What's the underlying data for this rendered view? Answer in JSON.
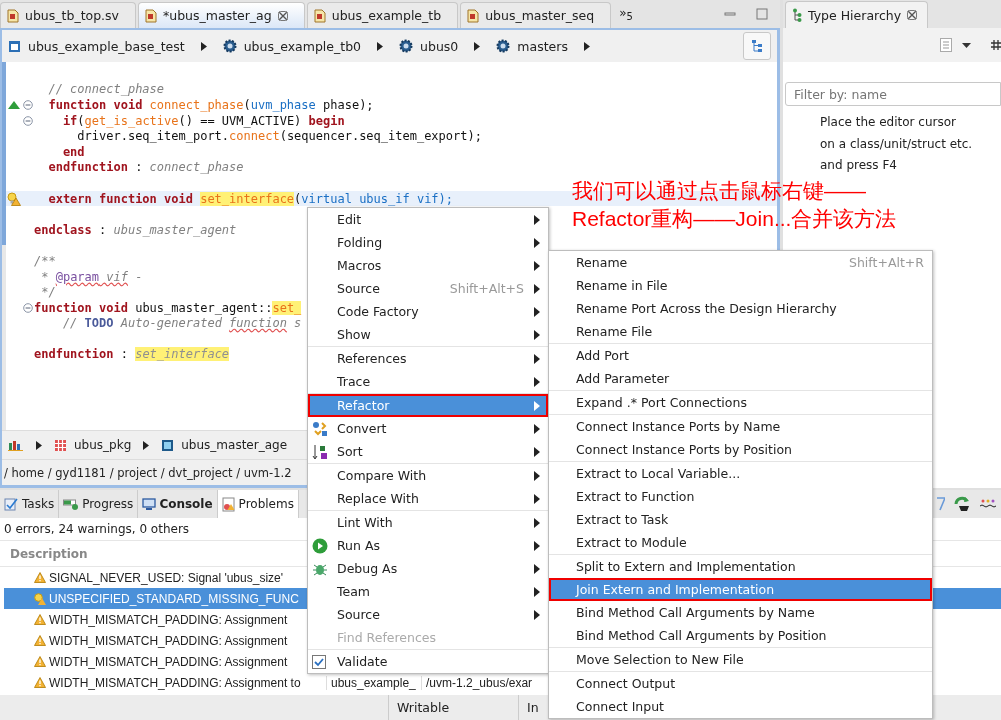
{
  "editor_tabs": [
    {
      "label": "ubus_tb_top.sv",
      "selected": false
    },
    {
      "label": "*ubus_master_ag",
      "selected": true
    },
    {
      "label": "ubus_example_tb",
      "selected": false
    },
    {
      "label": "ubus_master_seq",
      "selected": false
    }
  ],
  "tab_overflow": "»$_{5}$",
  "breadcrumb": [
    {
      "label": "ubus_example_base_test",
      "kind": "test"
    },
    {
      "label": "ubus_example_tb0",
      "kind": "instance"
    },
    {
      "label": "ubus0",
      "kind": "instance"
    },
    {
      "label": "masters",
      "kind": "instance"
    }
  ],
  "code_lines": [
    {
      "kind": "blank"
    },
    {
      "kind": "code",
      "fold": false,
      "current": false,
      "tokens": [
        {
          "text": "  // connect_phase",
          "kind": "comment"
        }
      ]
    },
    {
      "kind": "override",
      "fold": true,
      "current": false,
      "tokens": [
        {
          "text": "  function void ",
          "kind": "keyword"
        },
        {
          "text": "connect_phase",
          "kind": "function"
        },
        {
          "text": "(",
          "kind": "plain"
        },
        {
          "text": "uvm_phase",
          "kind": "type"
        },
        {
          "text": " phase);",
          "kind": "plain"
        }
      ]
    },
    {
      "kind": "code",
      "fold": true,
      "current": false,
      "tokens": [
        {
          "text": "    if",
          "kind": "keyword"
        },
        {
          "text": "(",
          "kind": "plain"
        },
        {
          "text": "get_is_active",
          "kind": "function"
        },
        {
          "text": "() == UVM_ACTIVE) ",
          "kind": "plain"
        },
        {
          "text": "begin",
          "kind": "keyword"
        }
      ]
    },
    {
      "kind": "code",
      "fold": false,
      "current": false,
      "tokens": [
        {
          "text": "      driver.seq_item_port.",
          "kind": "plain"
        },
        {
          "text": "connect",
          "kind": "function"
        },
        {
          "text": "(sequencer.seq_item_export);",
          "kind": "plain"
        }
      ]
    },
    {
      "kind": "code",
      "fold": false,
      "current": false,
      "tokens": [
        {
          "text": "    end",
          "kind": "keyword"
        }
      ]
    },
    {
      "kind": "code",
      "fold": false,
      "current": false,
      "tokens": [
        {
          "text": "  endfunction",
          "kind": "keyword"
        },
        {
          "text": " : ",
          "kind": "plain"
        },
        {
          "text": "connect_phase",
          "kind": "comment"
        }
      ]
    },
    {
      "kind": "blank"
    },
    {
      "kind": "warning",
      "fold": false,
      "current": true,
      "tokens": [
        {
          "text": "  extern function void ",
          "kind": "keyword"
        },
        {
          "text": "set_interface",
          "kind": "highlight"
        },
        {
          "text": "(",
          "kind": "plain"
        },
        {
          "text": "virtual ubus_if vif);",
          "kind": "type"
        }
      ]
    },
    {
      "kind": "blank"
    },
    {
      "kind": "code",
      "fold": false,
      "current": false,
      "tokens": [
        {
          "text": "endclass",
          "kind": "keyword"
        },
        {
          "text": " : ",
          "kind": "plain"
        },
        {
          "text": "ubus_master_agent",
          "kind": "comment"
        }
      ]
    },
    {
      "kind": "blank"
    },
    {
      "kind": "code",
      "fold": false,
      "current": false,
      "tokens": [
        {
          "text": "/**",
          "kind": "comment"
        }
      ]
    },
    {
      "kind": "code",
      "fold": false,
      "current": false,
      "tokens": [
        {
          "text": " * ",
          "kind": "comment"
        },
        {
          "text": "@param",
          "kind": "doctag"
        },
        {
          "text": " vif",
          "kind": "misspelled"
        },
        {
          "text": " -",
          "kind": "comment"
        }
      ]
    },
    {
      "kind": "code",
      "fold": false,
      "current": false,
      "tokens": [
        {
          "text": " */",
          "kind": "comment"
        }
      ]
    },
    {
      "kind": "code",
      "fold": true,
      "current": false,
      "tokens": [
        {
          "text": "function void ",
          "kind": "keyword"
        },
        {
          "text": "ubus_master_agent::",
          "kind": "plain"
        },
        {
          "text": "set_",
          "kind": "highlight"
        }
      ]
    },
    {
      "kind": "code",
      "fold": false,
      "current": false,
      "tokens": [
        {
          "text": "    // ",
          "kind": "comment"
        },
        {
          "text": "TODO",
          "kind": "todo"
        },
        {
          "text": " Auto-generated ",
          "kind": "comment"
        },
        {
          "text": "function",
          "kind": "misspelled"
        },
        {
          "text": " s",
          "kind": "comment"
        }
      ]
    },
    {
      "kind": "blank"
    },
    {
      "kind": "code",
      "fold": false,
      "current": false,
      "tokens": [
        {
          "text": "endfunction",
          "kind": "keyword"
        },
        {
          "text": " : ",
          "kind": "plain"
        },
        {
          "text": "set_interface",
          "kind": "highlight-italic"
        }
      ]
    }
  ],
  "breadcrumb_2": [
    {
      "label": "ubus_pkg",
      "kind": "package"
    },
    {
      "label": "ubus_master_age",
      "kind": "class"
    }
  ],
  "file_path": "/ home / gyd1181 / project / dvt_project / uvm-1.2",
  "type_hierarchy": {
    "title": "Type Hierarchy",
    "filter_placeholder": "Filter by: name",
    "message": [
      "Place the editor cursor",
      "on a class/unit/struct etc.",
      "and press F4"
    ]
  },
  "bottom_tabs": [
    {
      "label": "Tasks",
      "kind": "tasks",
      "selected": false,
      "bold": false
    },
    {
      "label": "Progress",
      "kind": "progress",
      "selected": false,
      "bold": false
    },
    {
      "label": "Console",
      "kind": "console",
      "selected": false,
      "bold": true
    },
    {
      "label": "Problems",
      "kind": "problems",
      "selected": true,
      "bold": false
    }
  ],
  "problems": {
    "summary": "0 errors, 24 warnings, 0 others",
    "column": "Description",
    "rows": [
      {
        "description": "SIGNAL_NEVER_USED: Signal 'ubus_size'",
        "kind": "warning",
        "selected": false
      },
      {
        "description": "UNSPECIFIED_STANDARD_MISSING_FUNC",
        "kind": "fixable",
        "selected": true
      },
      {
        "description": "WIDTH_MISMATCH_PADDING: Assignment",
        "kind": "warning",
        "selected": false
      },
      {
        "description": "WIDTH_MISMATCH_PADDING: Assignment",
        "kind": "warning",
        "selected": false
      },
      {
        "description": "WIDTH_MISMATCH_PADDING: Assignment",
        "kind": "warning",
        "selected": false
      },
      {
        "description": "WIDTH_MISMATCH_PADDING: Assignment to",
        "resource": "ubus_example_",
        "path": "/uvm-1.2_ubus/exar",
        "kind": "warning",
        "selected": false
      }
    ]
  },
  "status_bar": [
    "Writable",
    "In"
  ],
  "context_menu": [
    [
      {
        "label": "Edit",
        "kind": "plain",
        "submenu": true,
        "selected": false,
        "disabled": false
      },
      {
        "label": "Folding",
        "kind": "plain",
        "submenu": true,
        "selected": false,
        "disabled": false
      },
      {
        "label": "Macros",
        "kind": "plain",
        "submenu": true,
        "selected": false,
        "disabled": false
      },
      {
        "label": "Source",
        "shortcut": "Shift+Alt+S",
        "kind": "plain",
        "submenu": true,
        "selected": false,
        "disabled": false
      },
      {
        "label": "Code Factory",
        "kind": "plain",
        "submenu": true,
        "selected": false,
        "disabled": false
      },
      {
        "label": "Show",
        "kind": "plain",
        "submenu": true,
        "selected": false,
        "disabled": false
      }
    ],
    [
      {
        "label": "References",
        "kind": "plain",
        "submenu": true,
        "selected": false,
        "disabled": false
      },
      {
        "label": "Trace",
        "kind": "plain",
        "submenu": true,
        "selected": false,
        "disabled": false
      }
    ],
    [
      {
        "label": "Refactor",
        "kind": "plain",
        "submenu": true,
        "selected": true,
        "outlined": true,
        "disabled": false
      },
      {
        "label": "Convert",
        "kind": "convert",
        "submenu": true,
        "selected": false,
        "disabled": false
      },
      {
        "label": "Sort",
        "kind": "sort",
        "submenu": true,
        "selected": false,
        "disabled": false
      }
    ],
    [
      {
        "label": "Compare With",
        "kind": "plain",
        "submenu": true,
        "selected": false,
        "disabled": false
      },
      {
        "label": "Replace With",
        "kind": "plain",
        "submenu": true,
        "selected": false,
        "disabled": false
      }
    ],
    [
      {
        "label": "Lint With",
        "kind": "plain",
        "submenu": true,
        "selected": false,
        "disabled": false
      },
      {
        "label": "Run As",
        "kind": "run",
        "submenu": true,
        "selected": false,
        "disabled": false
      },
      {
        "label": "Debug As",
        "kind": "debug",
        "submenu": true,
        "selected": false,
        "disabled": false
      },
      {
        "label": "Team",
        "kind": "plain",
        "submenu": true,
        "selected": false,
        "disabled": false
      },
      {
        "label": "Source",
        "kind": "plain",
        "submenu": true,
        "selected": false,
        "disabled": false
      },
      {
        "label": "Find References",
        "kind": "plain",
        "submenu": false,
        "selected": false,
        "disabled": true
      }
    ],
    [
      {
        "label": "Validate",
        "kind": "checkbox",
        "checked": true,
        "submenu": false,
        "selected": false,
        "disabled": false
      }
    ]
  ],
  "refactor_menu": [
    [
      {
        "label": "Rename",
        "shortcut": "Shift+Alt+R",
        "selected": false
      },
      {
        "label": "Rename in File",
        "selected": false
      },
      {
        "label": "Rename Port Across the Design Hierarchy",
        "selected": false
      },
      {
        "label": "Rename File",
        "selected": false
      }
    ],
    [
      {
        "label": "Add Port",
        "selected": false
      },
      {
        "label": "Add Parameter",
        "selected": false
      }
    ],
    [
      {
        "label": "Expand .* Port Connections",
        "selected": false
      }
    ],
    [
      {
        "label": "Connect Instance Ports by Name",
        "selected": false
      },
      {
        "label": "Connect Instance Ports by Position",
        "selected": false
      }
    ],
    [
      {
        "label": "Extract to Local Variable...",
        "selected": false
      },
      {
        "label": "Extract to Function",
        "selected": false
      },
      {
        "label": "Extract to Task",
        "selected": false
      },
      {
        "label": "Extract to Module",
        "selected": false
      }
    ],
    [
      {
        "label": "Split to Extern and Implementation",
        "selected": false
      },
      {
        "label": "Join Extern and Implementation",
        "selected": true,
        "outlined": true
      },
      {
        "label": "Bind Method Call Arguments by Name",
        "selected": false
      },
      {
        "label": "Bind Method Call Arguments by Position",
        "selected": false
      }
    ],
    [
      {
        "label": "Move Selection to New File",
        "selected": false
      }
    ],
    [
      {
        "label": "Connect Output",
        "selected": false
      },
      {
        "label": "Connect Input",
        "selected": false
      }
    ]
  ],
  "annotation": "我们可以通过点击鼠标右键——\nRefactor重构——Join...合并该方法"
}
